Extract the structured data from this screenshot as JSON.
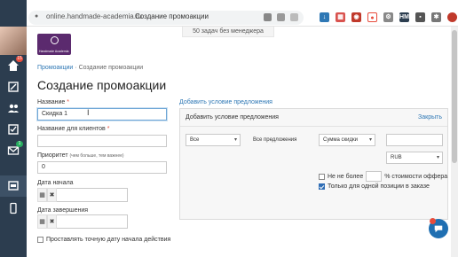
{
  "browser": {
    "url": "online.handmade-academia.ru",
    "tab_title": "Создание промоакции"
  },
  "sidebar": {
    "badges": {
      "home": "15",
      "messages": "1"
    }
  },
  "header": {
    "tasks_banner": "50 задач без менеджера",
    "logo_text": "Handmade Academia"
  },
  "breadcrumb": {
    "parent": "Промоакции",
    "separator": "·",
    "current": "Создание промоакции"
  },
  "page": {
    "title": "Создание промоакции"
  },
  "form": {
    "name_label": "Название",
    "name_value": "Скидка 1",
    "client_name_label": "Название для клиентов",
    "client_name_value": "",
    "priority_label": "Приоритет",
    "priority_hint": "(чем больше, тем важнее)",
    "priority_value": "0",
    "start_date_label": "Дата начала",
    "end_date_label": "Дата завершения",
    "checkbox_label": "Проставлять точную дату начала действия",
    "required_mark": "*"
  },
  "conditions": {
    "add_link": "Добавить условие предложения",
    "panel_title": "Добавить условие предложения",
    "close_link": "Закрыть",
    "scope_select": "Все",
    "offers_text": "Все предложения",
    "type_select": "Сумма скидки",
    "amount_value": "",
    "currency_select": "RUB",
    "max_label_prefix": "Не не более",
    "max_label_suffix": "% стоимости оффера",
    "single_label": "Только для одной позиции в заказе",
    "single_checked": true,
    "max_checked": false
  }
}
